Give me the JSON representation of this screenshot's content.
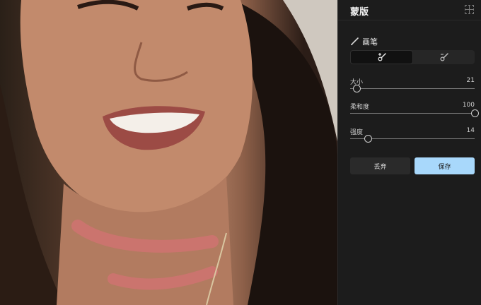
{
  "panel": {
    "title": "蒙版",
    "brush_label": "画笔"
  },
  "sliders": [
    {
      "label": "大小",
      "value": "21",
      "level": 0.05
    },
    {
      "label": "柔和度",
      "value": "100",
      "level": 1.0
    },
    {
      "label": "强度",
      "value": "14",
      "level": 0.14
    }
  ],
  "buttons": {
    "discard": "丢弃",
    "save": "保存"
  },
  "icons": {
    "header": "fit-to-screen-icon",
    "brush": "brush-icon",
    "mode_add": "brush-add-icon",
    "mode_erase": "brush-erase-icon"
  },
  "colors": {
    "accent": "#a8d8fb",
    "panel_bg": "#1c1c1c",
    "mask_overlay": "#e0707a"
  }
}
